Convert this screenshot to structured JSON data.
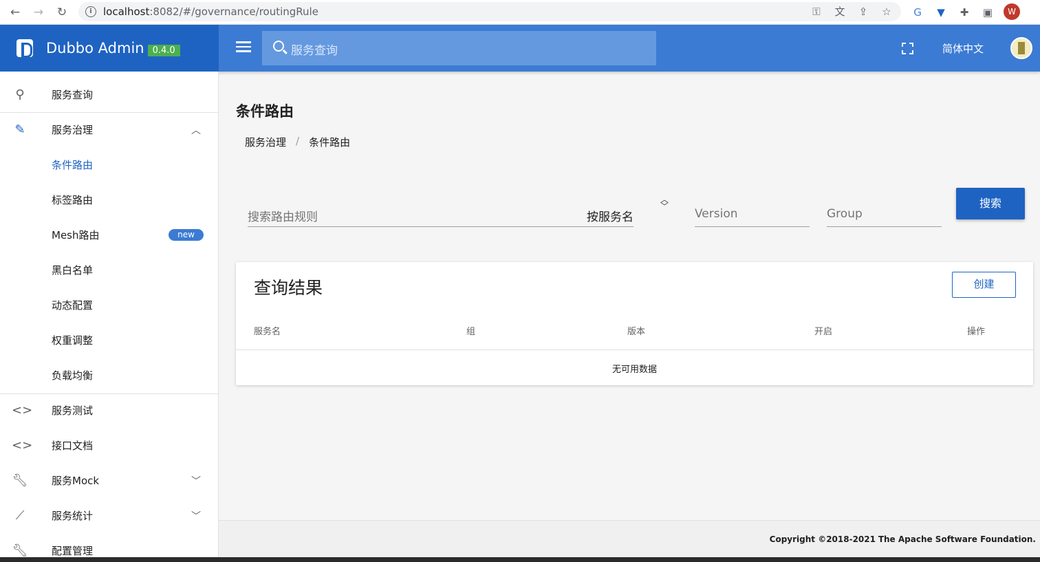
{
  "browser": {
    "url_host": "localhost",
    "url_rest": ":8082/#/governance/routingRule",
    "profile_initial": "W"
  },
  "header": {
    "brand_name": "Dubbo Admin",
    "version": "0.4.0",
    "search_placeholder": "服务查询",
    "language": "简体中文"
  },
  "sidebar": {
    "items": [
      {
        "label": "服务查询",
        "icon": "search-icon"
      },
      {
        "label": "服务治理",
        "icon": "pencil-icon"
      },
      {
        "label": "条件路由"
      },
      {
        "label": "标签路由"
      },
      {
        "label": "Mesh路由",
        "badge": "new"
      },
      {
        "label": "黑白名单"
      },
      {
        "label": "动态配置"
      },
      {
        "label": "权重调整"
      },
      {
        "label": "负载均衡"
      },
      {
        "label": "服务测试",
        "icon": "code-icon"
      },
      {
        "label": "接口文档",
        "icon": "code-icon"
      },
      {
        "label": "服务Mock",
        "icon": "wrench-icon"
      },
      {
        "label": "服务统计",
        "icon": "chart-icon"
      },
      {
        "label": "配置管理",
        "icon": "wrench-icon"
      }
    ]
  },
  "main": {
    "title": "条件路由",
    "breadcrumb": [
      "服务治理",
      "/",
      "条件路由"
    ],
    "filters": {
      "rule_placeholder": "搜索路由规则",
      "mode": "按服务名",
      "version_placeholder": "Version",
      "group_placeholder": "Group",
      "search_button": "搜索"
    },
    "results": {
      "title": "查询结果",
      "create_button": "创建",
      "columns": [
        "服务名",
        "组",
        "版本",
        "开启",
        "操作"
      ],
      "empty_text": "无可用数据"
    }
  },
  "footer": {
    "copyright": "Copyright ©2018-2021",
    "org": "The Apache Software Foundation."
  },
  "colors": {
    "brand_dark": "#1f63c2",
    "brand": "#3b7bd4",
    "badge_green": "#4caf50"
  }
}
